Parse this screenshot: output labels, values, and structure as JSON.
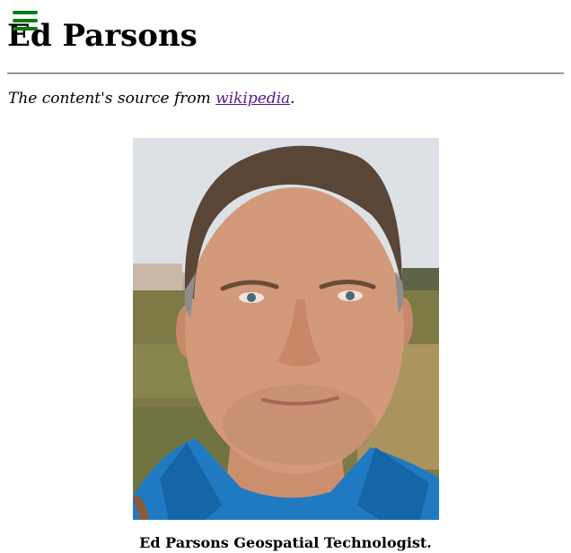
{
  "header": {
    "title": "Ed Parsons"
  },
  "source": {
    "prefix": "The content's source from ",
    "link_text": "wikipedia",
    "suffix": "."
  },
  "figure": {
    "caption": "Ed Parsons Geospatial Technologist.",
    "image_description": "portrait photo of a smiling man in a blue shirt outdoors"
  },
  "colors": {
    "menu_icon": "#0a7a12",
    "link": "#551a8b"
  },
  "icons": {
    "menu": "hamburger-menu-icon"
  }
}
